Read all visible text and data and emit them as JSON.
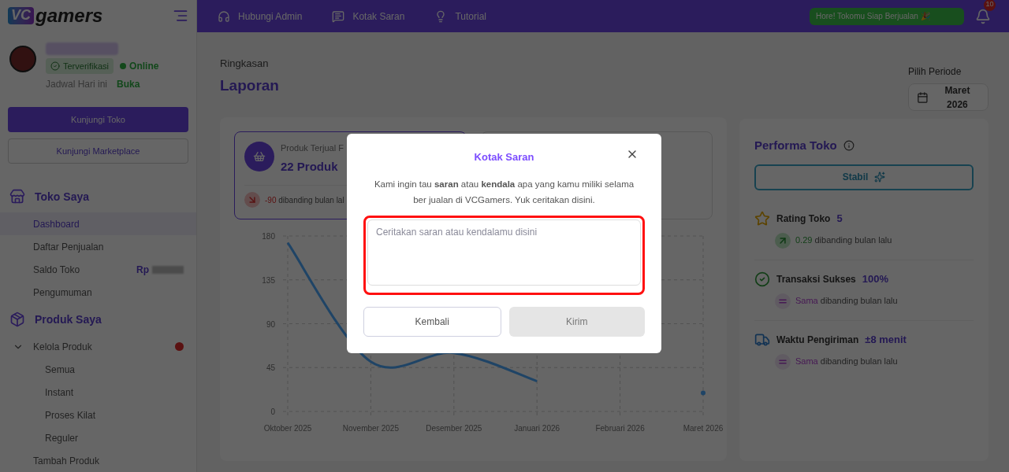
{
  "logo": {
    "mark": "VC",
    "word": "gamers"
  },
  "sidebar": {
    "profile": {
      "verified_badge": "Terverifikasi",
      "status": "Online",
      "online": true,
      "schedule_label": "Jadwal Hari ini",
      "schedule_value": "Buka"
    },
    "buttons": [
      {
        "kind": "primary",
        "label": "Kunjungi Toko"
      },
      {
        "kind": "outline",
        "label": "Kunjungi Marketplace"
      }
    ],
    "sections": [
      {
        "title": "Toko Saya",
        "kind": "store",
        "items": [
          {
            "label": "Dashboard",
            "selected": true
          },
          {
            "label": "Daftar Penjualan",
            "selected": false
          },
          {
            "label": "Saldo Toko",
            "selected": false,
            "amount_prefix": "Rp"
          },
          {
            "label": "Pengumuman",
            "selected": false
          }
        ]
      },
      {
        "title": "Produk Saya",
        "kind": "box",
        "items": [
          {
            "label": "Kelola Produk",
            "selected": false,
            "expanded": true,
            "alert": true,
            "children": [
              {
                "label": "Semua",
                "selected": false
              },
              {
                "label": "Instant",
                "selected": false
              },
              {
                "label": "Proses Kilat",
                "selected": false
              },
              {
                "label": "Reguler",
                "selected": false
              }
            ]
          },
          {
            "label": "Tambah Produk",
            "selected": false
          }
        ]
      }
    ]
  },
  "topbar": {
    "nav": [
      {
        "kind": "headset",
        "label": "Hubungi Admin"
      },
      {
        "kind": "chat",
        "label": "Kotak Saran"
      },
      {
        "kind": "bulb",
        "label": "Tutorial"
      }
    ],
    "banner": "Hore! Tokomu Siap Berjualan 🎉",
    "notification_count": "10"
  },
  "header": {
    "subtitle": "Ringkasan",
    "title": "Laporan",
    "period_label": "Pilih Periode",
    "period_value": "Maret 2026"
  },
  "stat_cards": [
    {
      "selected": true,
      "title": "Produk Terjual F",
      "value": "22 Produk",
      "delta": {
        "kind": "down",
        "value": "-90",
        "text": "dibanding bulan lal"
      }
    },
    {
      "selected": false
    }
  ],
  "chart": {
    "chart_data": {
      "type": "line",
      "categories": [
        "Oktober 2025",
        "November 2025",
        "Desember 2025",
        "Januari 2026",
        "Februari 2026",
        "Maret 2026"
      ],
      "series": [
        {
          "color": "#1f4466",
          "values": [
            173,
            51,
            60,
            31,
            null,
            19
          ]
        }
      ],
      "ylim": [
        0,
        180
      ],
      "yticks": [
        0,
        45,
        90,
        135,
        180
      ],
      "grid": true
    }
  },
  "performance": {
    "title": "Performa Toko",
    "status": "Stabil",
    "metrics": [
      {
        "kind": "rating",
        "label": "Rating Toko",
        "value": "5",
        "delta": {
          "kind": "up",
          "value": "0.29",
          "text": "dibanding bulan lalu"
        }
      },
      {
        "kind": "success",
        "label": "Transaksi Sukses",
        "value": "100%",
        "delta": {
          "kind": "same",
          "value": "Sama",
          "text": "dibanding bulan lalu"
        }
      },
      {
        "kind": "shipping",
        "label": "Waktu Pengiriman",
        "value": "±8 menit",
        "delta": {
          "kind": "same",
          "value": "Sama",
          "text": "dibanding bulan lalu"
        }
      }
    ]
  },
  "modal": {
    "title": "Kotak Saran",
    "message": "Kami ingin tau **saran** atau **kendala** apa yang kamu miliki selama ber jualan di VCGamers. Yuk ceritakan disini.",
    "placeholder": "Ceritakan saran atau kendalamu disini",
    "highlighted": true,
    "buttons": [
      {
        "kind": "secondary",
        "label": "Kembali",
        "disabled": false
      },
      {
        "kind": "primary",
        "label": "Kirim",
        "disabled": true
      }
    ]
  }
}
